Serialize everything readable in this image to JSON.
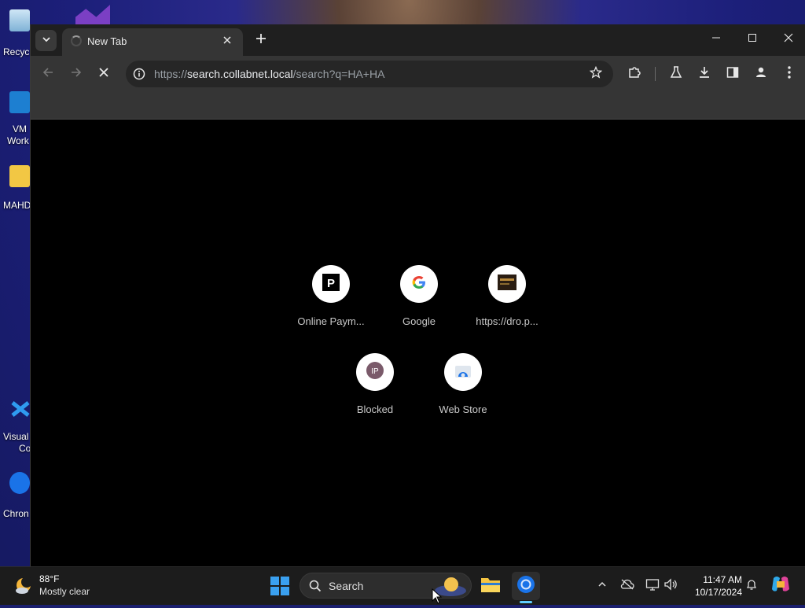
{
  "desktop": {
    "icons": [
      {
        "label": "Recyc",
        "name": "recycle-bin"
      },
      {
        "label": "VMw\nWork",
        "name": "vmware-workstation"
      },
      {
        "label": "MAHD",
        "name": "mahd-folder"
      },
      {
        "label": "Visual\nCo",
        "name": "visual-studio-code"
      },
      {
        "label": "Chron",
        "name": "chrome"
      }
    ]
  },
  "browser": {
    "tab": {
      "title": "New Tab"
    },
    "omnibox": {
      "scheme": "https://",
      "host": "search.collabnet.local",
      "path": "/search?q=HA+HA"
    },
    "shortcuts": [
      {
        "label": "Online Paym...",
        "icon": "p-letter-icon"
      },
      {
        "label": "Google",
        "icon": "google-g-icon"
      },
      {
        "label": "https://dro.p...",
        "icon": "site-thumbnail-icon"
      },
      {
        "label": "Blocked",
        "icon": "ip-icon"
      },
      {
        "label": "Web Store",
        "icon": "web-store-icon"
      }
    ]
  },
  "taskbar": {
    "weather": {
      "temp": "88°F",
      "condition": "Mostly clear"
    },
    "search_label": "Search",
    "clock": {
      "time": "11:47 AM",
      "date": "10/17/2024"
    }
  },
  "colors": {
    "tabstrip": "#1f1f1f",
    "toolbar": "#353535",
    "omnibox": "#262626",
    "content": "#000000",
    "taskbar": "#1c1c1c",
    "accent": "#60cdff"
  }
}
